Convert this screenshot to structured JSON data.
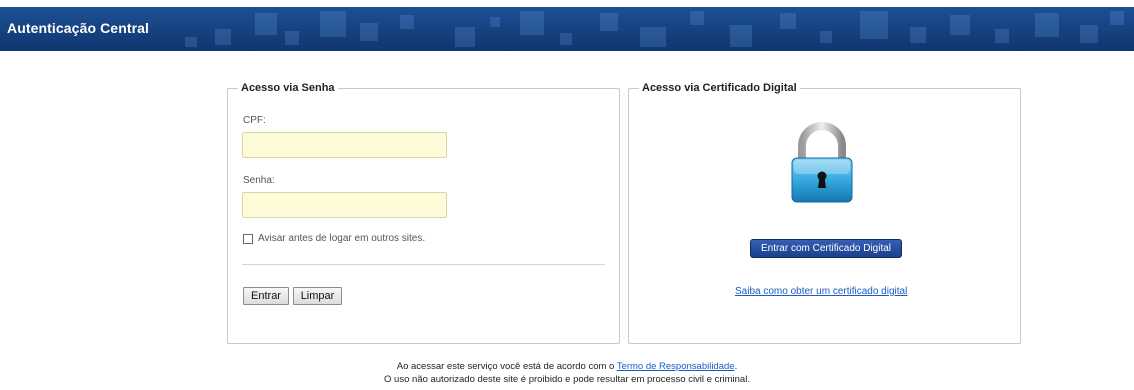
{
  "header": {
    "title": "Autenticação Central"
  },
  "senha_box": {
    "legend": "Acesso via Senha",
    "cpf_label": "CPF:",
    "cpf_value": "",
    "senha_label": "Senha:",
    "senha_value": "",
    "checkbox_label": "Avisar antes de logar em outros sites.",
    "checkbox_checked": false,
    "entrar_label": "Entrar",
    "limpar_label": "Limpar"
  },
  "cert_box": {
    "legend": "Acesso via Certificado Digital",
    "icon": "lock-icon",
    "button_label": "Entrar com Certificado Digital",
    "link_text": "Saiba como obter um certificado digital"
  },
  "footer": {
    "line1_prefix": "Ao acessar este serviço você está de acordo com o ",
    "line1_link": "Termo de Responsabilidade",
    "line1_suffix": ".",
    "line2": "O uso não autorizado deste site é proibido e pode resultar em processo civil e criminal."
  },
  "colors": {
    "header_bg": "#15427f",
    "input_bg": "#fdfbd8",
    "cert_button": "#1a3f8c",
    "link": "#1a5bc4"
  }
}
